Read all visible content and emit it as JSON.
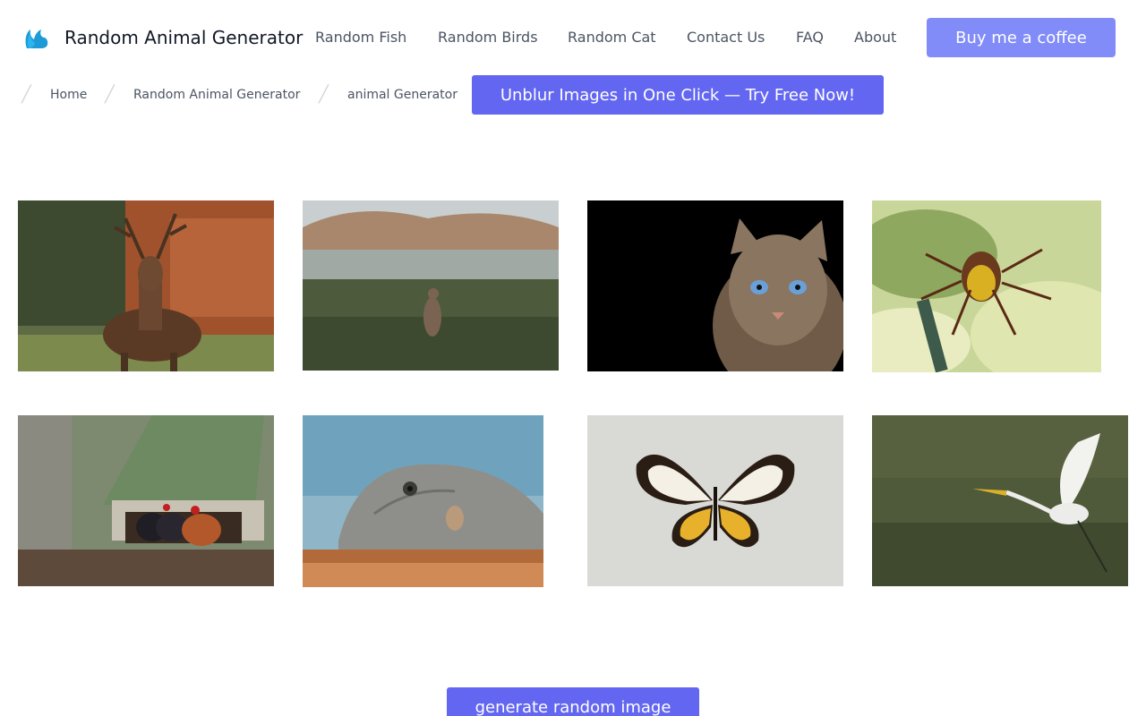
{
  "header": {
    "logo_icon": "squirrel-logo-icon",
    "brand": "Random Animal Generator",
    "nav": [
      "Random Fish",
      "Random Birds",
      "Random Cat",
      "Contact Us",
      "FAQ",
      "About"
    ],
    "coffee_button": "Buy me a coffee",
    "accent_color": "#818cf8"
  },
  "breadcrumb": {
    "items": [
      "Home",
      "Random Animal Generator",
      "animal Generator"
    ],
    "promo_button": "Unblur Images in One Click — Try Free Now!"
  },
  "gallery": {
    "images": [
      {
        "name": "deer-image",
        "subject": "deer"
      },
      {
        "name": "kangaroo-image",
        "subject": "kangaroo"
      },
      {
        "name": "cat-image",
        "subject": "cat"
      },
      {
        "name": "hornet-image",
        "subject": "hornet"
      },
      {
        "name": "chickens-image",
        "subject": "chickens"
      },
      {
        "name": "iguana-image",
        "subject": "iguana"
      },
      {
        "name": "butterfly-image",
        "subject": "butterfly"
      },
      {
        "name": "egret-image",
        "subject": "egret"
      }
    ]
  },
  "actions": {
    "generate_button": "generate random image",
    "button_color": "#6366f1"
  }
}
